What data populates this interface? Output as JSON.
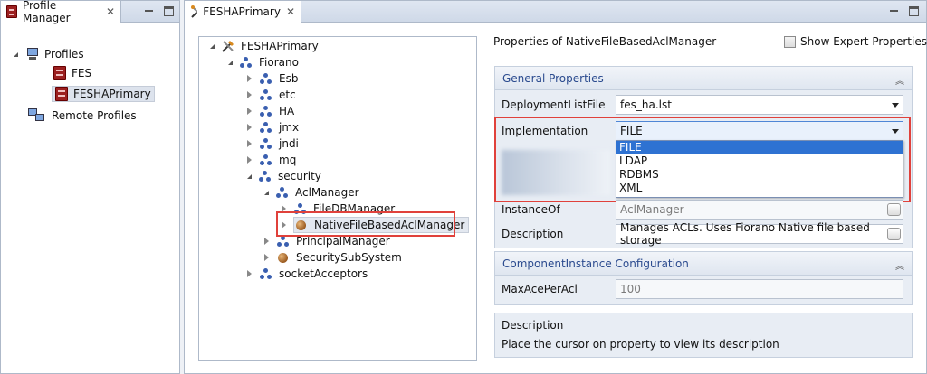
{
  "left_view": {
    "tab_title": "Profile Manager",
    "tree": {
      "profiles": "Profiles",
      "fes": "FES",
      "feshaprimary": "FESHAPrimary",
      "remote_profiles": "Remote Profiles"
    }
  },
  "editor": {
    "tab_title": "FESHAPrimary",
    "tree": {
      "root": "FESHAPrimary",
      "fiorano": "Fiorano",
      "esb": "Esb",
      "etc": "etc",
      "ha": "HA",
      "jmx": "jmx",
      "jndi": "jndi",
      "mq": "mq",
      "security": "security",
      "aclmanager": "AclManager",
      "filedbmanager": "FileDBManager",
      "nativefilebasedaclmanager": "NativeFileBasedAclManager",
      "principalmanager": "PrincipalManager",
      "securitysubsystem": "SecuritySubSystem",
      "socketacceptors": "socketAcceptors"
    },
    "properties": {
      "header": "Properties of NativeFileBasedAclManager",
      "show_expert": "Show Expert Properties",
      "general_section": "General Properties",
      "deploymentlistfile_label": "DeploymentListFile",
      "deploymentlistfile_value": "fes_ha.lst",
      "implementation_label": "Implementation",
      "implementation_value": "FILE",
      "implementation_options": [
        "FILE",
        "LDAP",
        "RDBMS",
        "XML"
      ],
      "instanceof_label": "InstanceOf",
      "instanceof_value": "AclManager",
      "description_label": "Description",
      "description_value": "Manages ACLs. Uses Fiorano Native file based storage",
      "component_section": "ComponentInstance Configuration",
      "maxaceperacl_label": "MaxAcePerAcl",
      "maxaceperacl_value": "100",
      "desc_box_title": "Description",
      "desc_box_text": "Place the cursor on property to view its description"
    }
  },
  "colors": {
    "highlight": "#e0413b",
    "selection": "#2e72d2",
    "section_title": "#2a4a8e"
  }
}
